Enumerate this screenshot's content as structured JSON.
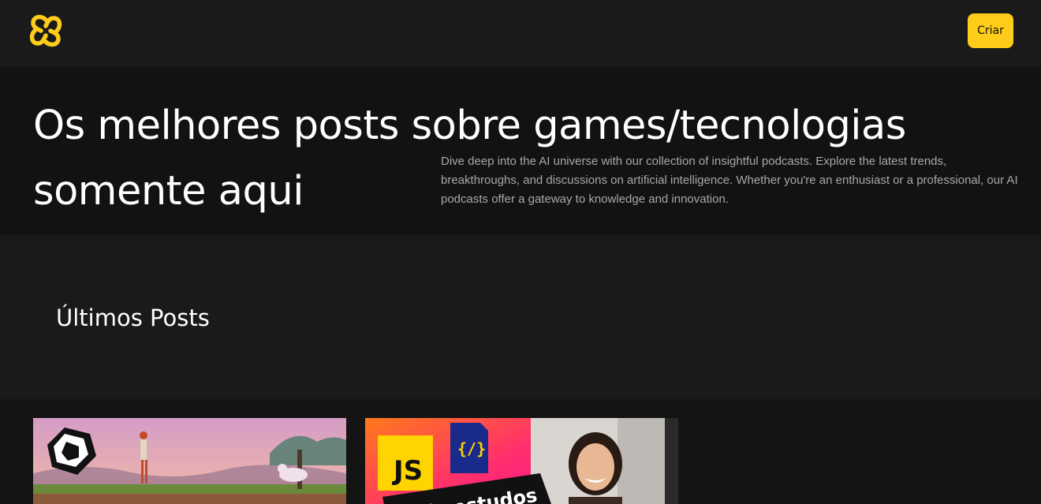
{
  "header": {
    "logo_icon": "yellow-knot-logo-icon",
    "create_label": "Criar",
    "accent_color": "#ffcc1a"
  },
  "hero": {
    "title": "Os melhores posts sobre games/tecnologias somente aqui",
    "description": "Dive deep into the AI universe with our collection of insightful podcasts. Explore the latest trends, breakthroughs, and discussions on artificial intelligence. Whether you're an enthusiast or a professional, our AI podcasts offer a gateway to knowledge and innovation."
  },
  "latest": {
    "title": "Últimos Posts"
  },
  "posts": [
    {
      "thumbnail": "unity-game-thumbnail"
    },
    {
      "thumbnail": "js-study-thumbnail",
      "badge_text": "JS",
      "icon_text": "{/}",
      "banner_text": "de estudos"
    }
  ]
}
